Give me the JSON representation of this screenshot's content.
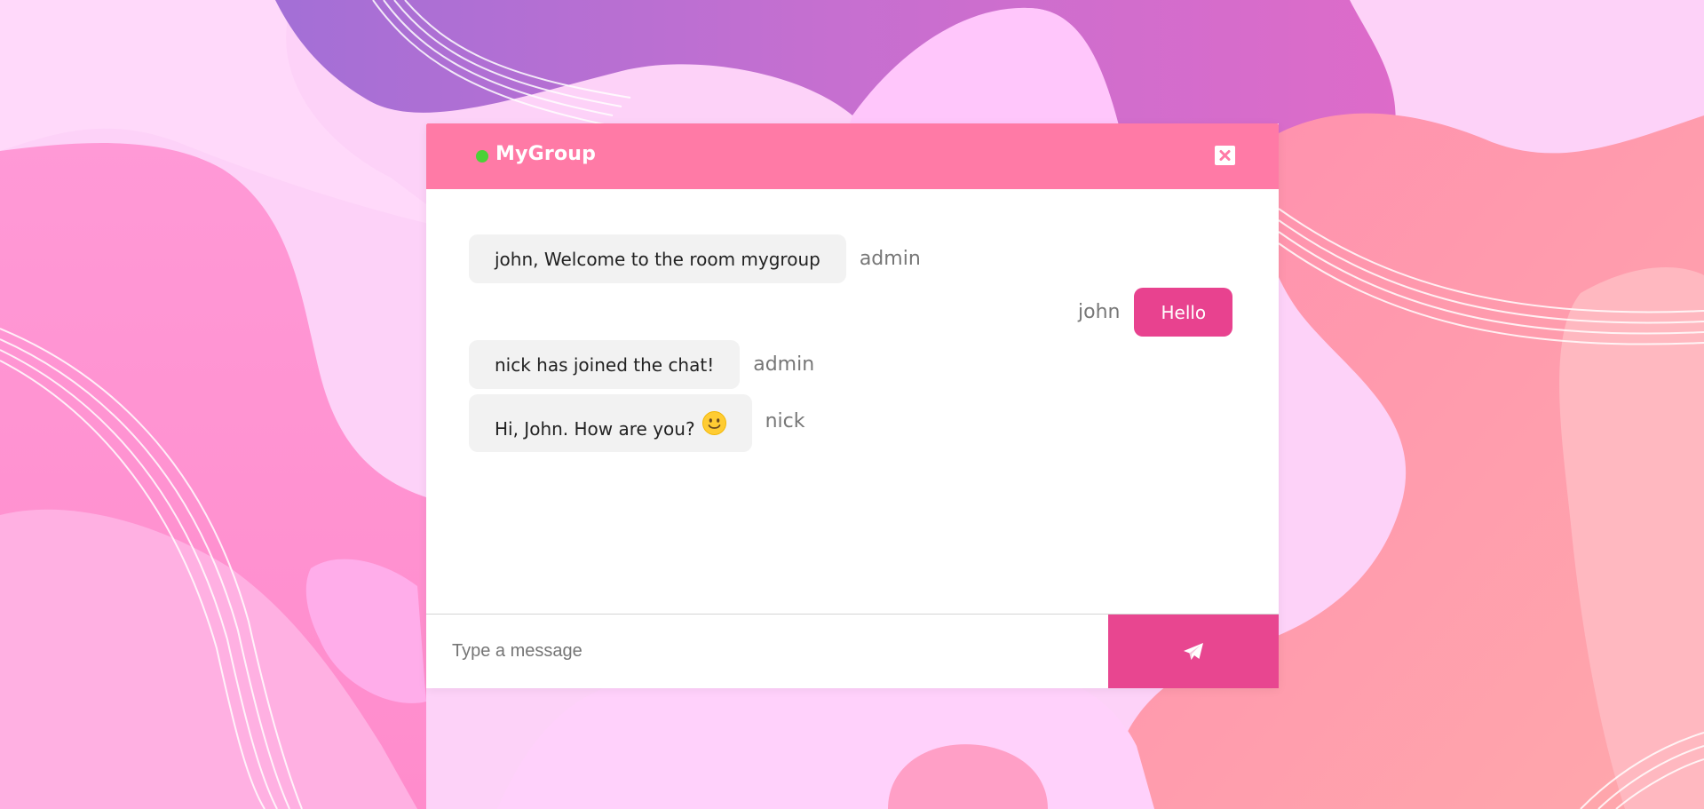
{
  "room": {
    "name": "MyGroup",
    "online": true,
    "status_color": "#4cd137"
  },
  "header": {
    "close_icon": "close-icon"
  },
  "messages": [
    {
      "text": "john, Welcome to the room mygroup",
      "sender": "admin",
      "direction": "incoming"
    },
    {
      "text": "Hello",
      "sender": "john",
      "direction": "outgoing"
    },
    {
      "text": "nick has joined the chat!",
      "sender": "admin",
      "direction": "incoming"
    },
    {
      "text": "Hi, John. How are you?",
      "sender": "nick",
      "direction": "incoming",
      "emoji": "slightly-smiling-face-icon"
    }
  ],
  "composer": {
    "value": "",
    "placeholder": "Type a message",
    "send_icon": "paper-plane-icon"
  },
  "colors": {
    "header": "#ff7aa6",
    "outgoing_bubble": "#e8428f",
    "incoming_bubble": "#f2f2f2",
    "send_button": "#e84690"
  }
}
